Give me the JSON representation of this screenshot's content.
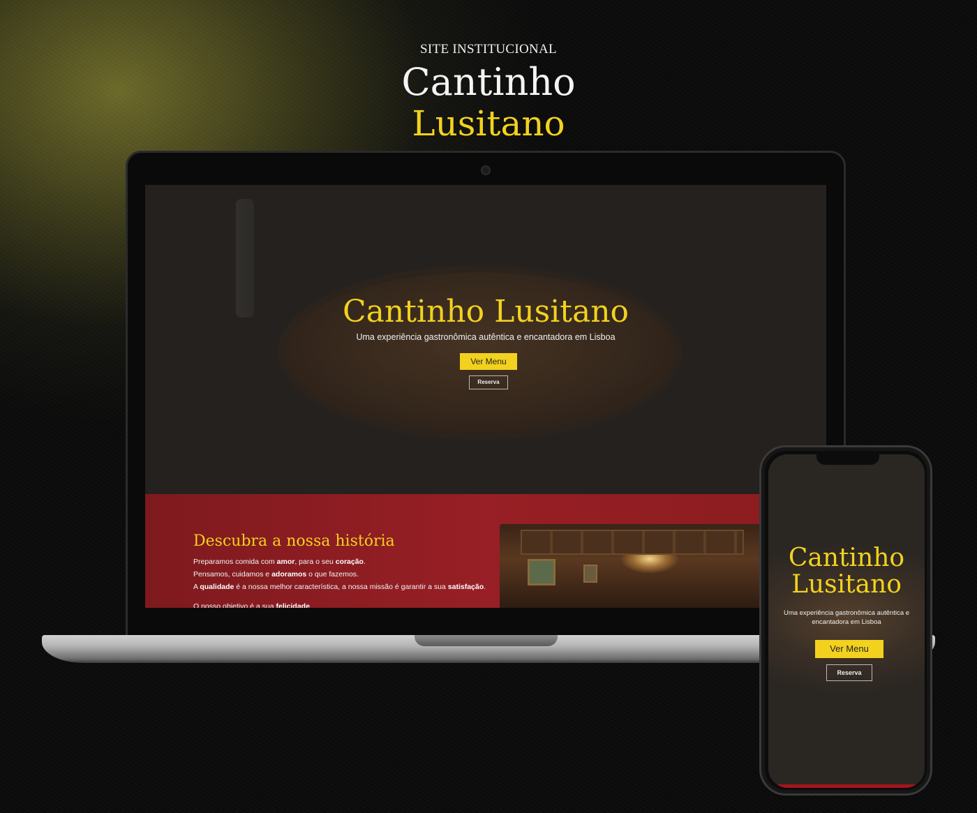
{
  "branding": {
    "kicker": "SITE INSTITUCIONAL",
    "title_line1": "Cantinho",
    "title_line2": "Lusitano"
  },
  "colors": {
    "accent_yellow": "#f2d21e",
    "section_red": "#971f25",
    "dark_background": "#0b0b0b"
  },
  "desktop": {
    "hero": {
      "title": "Cantinho Lusitano",
      "subtitle": "Uma experiência gastronômica autêntica e encantadora em Lisboa",
      "menu_button": "Ver Menu",
      "reserve_button": "Reserva"
    },
    "story": {
      "title": "Descubra a nossa história",
      "p1_a": "Preparamos comida com ",
      "p1_b": "amor",
      "p1_c": ", para o seu ",
      "p1_d": "coração",
      "p1_e": ".",
      "p2_a": "Pensamos, cuidamos e ",
      "p2_b": "adoramos",
      "p2_c": " o que fazemos.",
      "p3_a": "A ",
      "p3_b": "qualidade",
      "p3_c": " é a nossa melhor característica, a nossa missão é garantir a sua ",
      "p3_d": "satisfação",
      "p3_e": ".",
      "p4_a": "O nosso objetivo é a sua ",
      "p4_b": "felicidade"
    }
  },
  "mobile": {
    "title_line1": "Cantinho",
    "title_line2": "Lusitano",
    "subtitle": "Uma experiência gastronômica autêntica e encantadora em Lisboa",
    "menu_button": "Ver Menu",
    "reserve_button": "Reserva"
  }
}
